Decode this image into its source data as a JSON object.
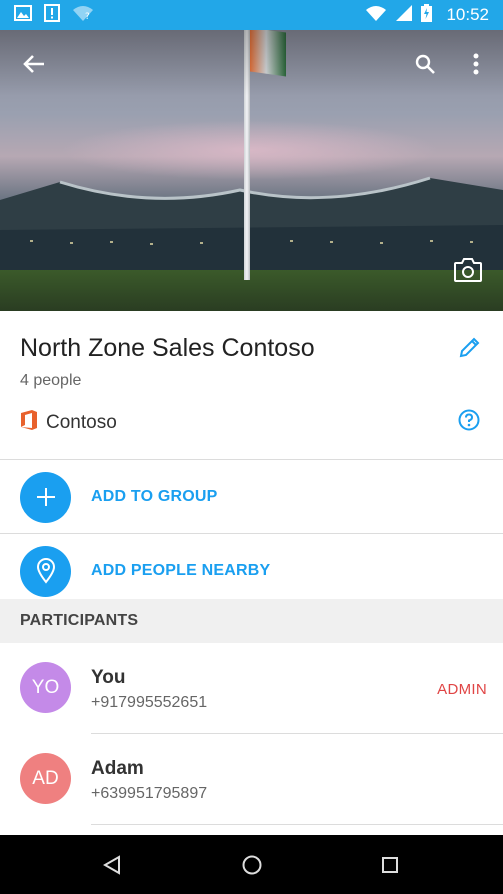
{
  "status_bar": {
    "time": "10:52",
    "icons_left": [
      "image-icon",
      "alert-icon",
      "wifi-question-icon"
    ],
    "icons_right": [
      "wifi-icon",
      "signal-icon",
      "battery-charging-icon"
    ]
  },
  "header": {
    "back_icon": "back-arrow-icon",
    "search_icon": "search-icon",
    "more_icon": "more-vert-icon",
    "camera_icon": "camera-icon"
  },
  "group": {
    "title": "North Zone Sales Contoso",
    "people_count": "4 people",
    "org_name": "Contoso"
  },
  "actions": [
    {
      "label": "ADD TO GROUP",
      "icon": "plus-icon"
    },
    {
      "label": "ADD PEOPLE NEARBY",
      "icon": "location-pin-icon"
    }
  ],
  "participants_header": "PARTICIPANTS",
  "participants": [
    {
      "initials": "YO",
      "name": "You",
      "phone": "+917995552651",
      "badge": "ADMIN",
      "avatar_color": "#c48ae8"
    },
    {
      "initials": "AD",
      "name": "Adam",
      "phone": "+639951795897",
      "badge": "",
      "avatar_color": "#ef8080"
    }
  ],
  "colors": {
    "accent": "#1a9ff0",
    "status_bar": "#22a7e8",
    "admin_badge": "#e04545",
    "office_logo": "#e8612c"
  }
}
